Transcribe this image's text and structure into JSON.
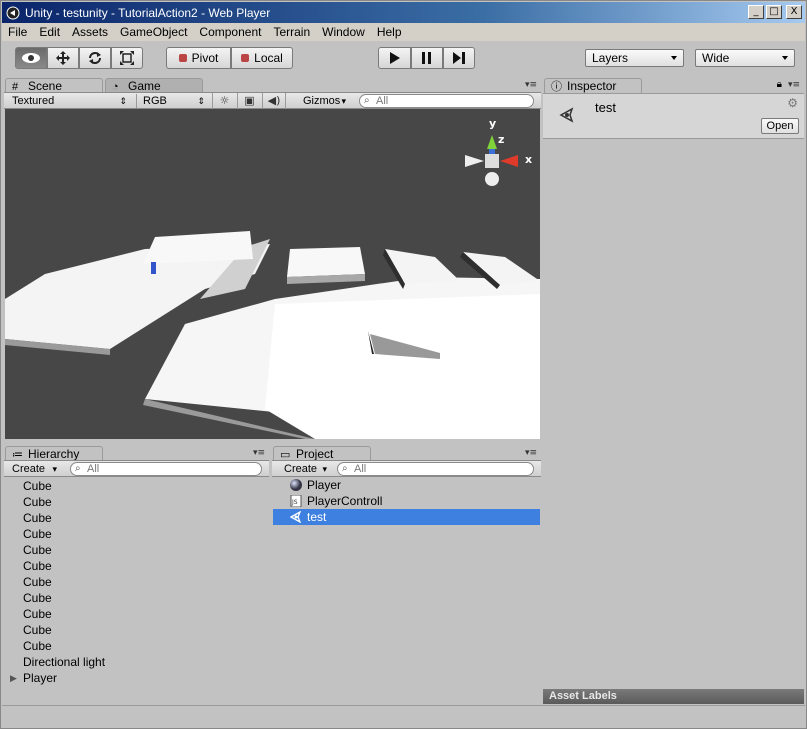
{
  "window": {
    "title": "Unity - testunity - TutorialAction2 - Web Player",
    "minimize": "_",
    "maximize": "□",
    "close": "X"
  },
  "menu": [
    "File",
    "Edit",
    "Assets",
    "GameObject",
    "Component",
    "Terrain",
    "Window",
    "Help"
  ],
  "toolbar": {
    "pivot_label": "Pivot",
    "local_label": "Local",
    "layers_label": "Layers",
    "layout_label": "Wide"
  },
  "scene_panel": {
    "tab_scene": "Scene",
    "tab_game": "Game",
    "render_mode": "Textured",
    "color_mode": "RGB",
    "gizmos_label": "Gizmos",
    "search_placeholder": "All",
    "axis_y": "y",
    "axis_z": "z",
    "axis_x": "x"
  },
  "inspector": {
    "tab_label": "Inspector",
    "object_name": "test",
    "open_button": "Open",
    "asset_labels": "Asset Labels"
  },
  "hierarchy": {
    "tab_label": "Hierarchy",
    "create_label": "Create",
    "search_placeholder": "All",
    "items": [
      {
        "label": "Cube"
      },
      {
        "label": "Cube"
      },
      {
        "label": "Cube"
      },
      {
        "label": "Cube"
      },
      {
        "label": "Cube"
      },
      {
        "label": "Cube"
      },
      {
        "label": "Cube"
      },
      {
        "label": "Cube"
      },
      {
        "label": "Cube"
      },
      {
        "label": "Cube"
      },
      {
        "label": "Cube"
      },
      {
        "label": "Directional light"
      },
      {
        "label": "Player"
      }
    ]
  },
  "project": {
    "tab_label": "Project",
    "create_label": "Create",
    "search_placeholder": "All",
    "items": [
      {
        "label": "Player",
        "icon": "sphere-icon"
      },
      {
        "label": "PlayerControll",
        "icon": "script-icon"
      },
      {
        "label": "test",
        "icon": "unity-scene-icon",
        "selected": true
      }
    ]
  },
  "colors": {
    "selection": "#3d80df",
    "scene_bg": "#474747",
    "panel_bg": "#c2c2c2"
  }
}
